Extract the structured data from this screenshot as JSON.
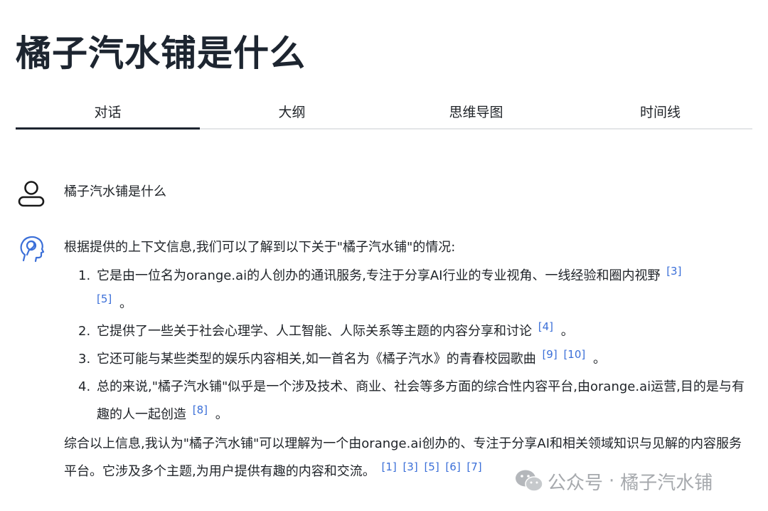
{
  "page": {
    "title": "橘子汽水铺是什么"
  },
  "tabs": [
    {
      "label": "对话",
      "active": true
    },
    {
      "label": "大纲",
      "active": false
    },
    {
      "label": "思维导图",
      "active": false
    },
    {
      "label": "时间线",
      "active": false
    }
  ],
  "conversation": {
    "user_message": "橘子汽水铺是什么",
    "answer": {
      "intro": "根据提供的上下文信息,我们可以了解到以下关于\"橘子汽水铺\"的情况:",
      "items": [
        {
          "num": "1.",
          "text": "它是由一位名为orange.ai的人创办的通讯服务,专注于分享AI行业的专业视角、一线经验和圈内视野",
          "cites": [
            "[3]",
            "[5]"
          ],
          "end": "。"
        },
        {
          "num": "2.",
          "text": "它提供了一些关于社会心理学、人工智能、人际关系等主题的内容分享和讨论",
          "cites": [
            "[4]"
          ],
          "end": "。"
        },
        {
          "num": "3.",
          "text": "它还可能与某些类型的娱乐内容相关,如一首名为《橘子汽水》的青春校园歌曲",
          "cites": [
            "[9]",
            "[10]"
          ],
          "end": "。"
        },
        {
          "num": "4.",
          "text": "总的来说,\"橘子汽水铺\"似乎是一个涉及技术、商业、社会等多方面的综合性内容平台,由orange.ai运营,目的是与有趣的人一起创造",
          "cites": [
            "[8]"
          ],
          "end": "。"
        }
      ],
      "summary": "综合以上信息,我认为\"橘子汽水铺\"可以理解为一个由orange.ai创办的、专注于分享AI和相关领域知识与见解的内容服务平台。它涉及多个主题,为用户提供有趣的内容和交流。",
      "summary_cites": [
        "[1]",
        "[3]",
        "[5]",
        "[6]",
        "[7]"
      ]
    }
  },
  "watermark": {
    "prefix": "公众号",
    "separator": "·",
    "name": "橘子汽水铺"
  },
  "colors": {
    "accent": "#3b6fd8",
    "title": "#1d2530",
    "tab_underline": "#1d2530",
    "divider": "#e3e5e8",
    "watermark": "#a6a9ad"
  },
  "icons": {
    "user_avatar": "person-outline-icon",
    "ai_avatar": "ai-head-icon",
    "watermark": "wechat-icon"
  }
}
